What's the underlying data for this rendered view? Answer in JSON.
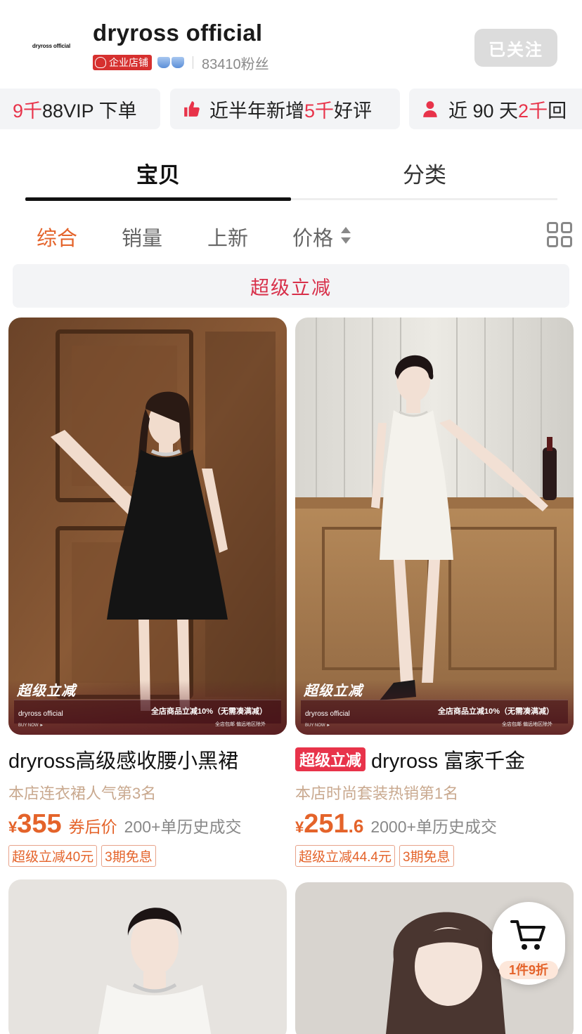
{
  "store": {
    "logo_text": "dryross official",
    "name": "dryross official",
    "badge": "企业店铺",
    "fans": "83410粉丝",
    "follow_label": "已关注"
  },
  "stats": [
    {
      "prefix": "9千",
      "suffix": "88VIP 下单",
      "icon": ""
    },
    {
      "prefix": "近半年新增",
      "red": "5千",
      "suffix": "好评",
      "icon": "thumbs-up-icon"
    },
    {
      "prefix": "近 90 天",
      "red": "2千",
      "suffix": "回",
      "icon": "person-icon"
    }
  ],
  "tabs": {
    "products": "宝贝",
    "categories": "分类"
  },
  "sort": {
    "overall": "综合",
    "sales": "销量",
    "new": "上新",
    "price": "价格"
  },
  "promo": "超级立减",
  "products": [
    {
      "overlay_title": "超级立减",
      "overlay_brand": "dryross official",
      "overlay_buy": "BUY NOW ►",
      "overlay_text": "全店商品立减10%（无需凑满减）",
      "overlay_sub": "全店包邮 偏远地区除外",
      "title": "dryross高级感收腰小黑裙",
      "rank": "本店连衣裙人气第3名",
      "yen": "¥",
      "price": "355",
      "price_dec": "",
      "after_coupon": "券后价",
      "sold": "200+单历史成交",
      "badges": [
        "超级立减40元",
        "3期免息"
      ]
    },
    {
      "overlay_title": "超级立减",
      "overlay_brand": "dryross official",
      "overlay_buy": "BUY NOW ►",
      "overlay_text": "全店商品立减10%（无需凑满减）",
      "overlay_sub": "全店包邮 偏远地区除外",
      "tag": "超级立减",
      "title": "dryross 富家千金",
      "rank": "本店时尚套装热销第1名",
      "yen": "¥",
      "price": "251",
      "price_dec": ".6",
      "sold": "2000+单历史成交",
      "badges": [
        "超级立减44.4元",
        "3期免息"
      ]
    }
  ],
  "fab": {
    "label": "1件9折",
    "icon": "cart-icon"
  },
  "colors": {
    "accent": "#e4632a",
    "red": "#e8334a",
    "chip_bg": "#f3f4f6"
  }
}
